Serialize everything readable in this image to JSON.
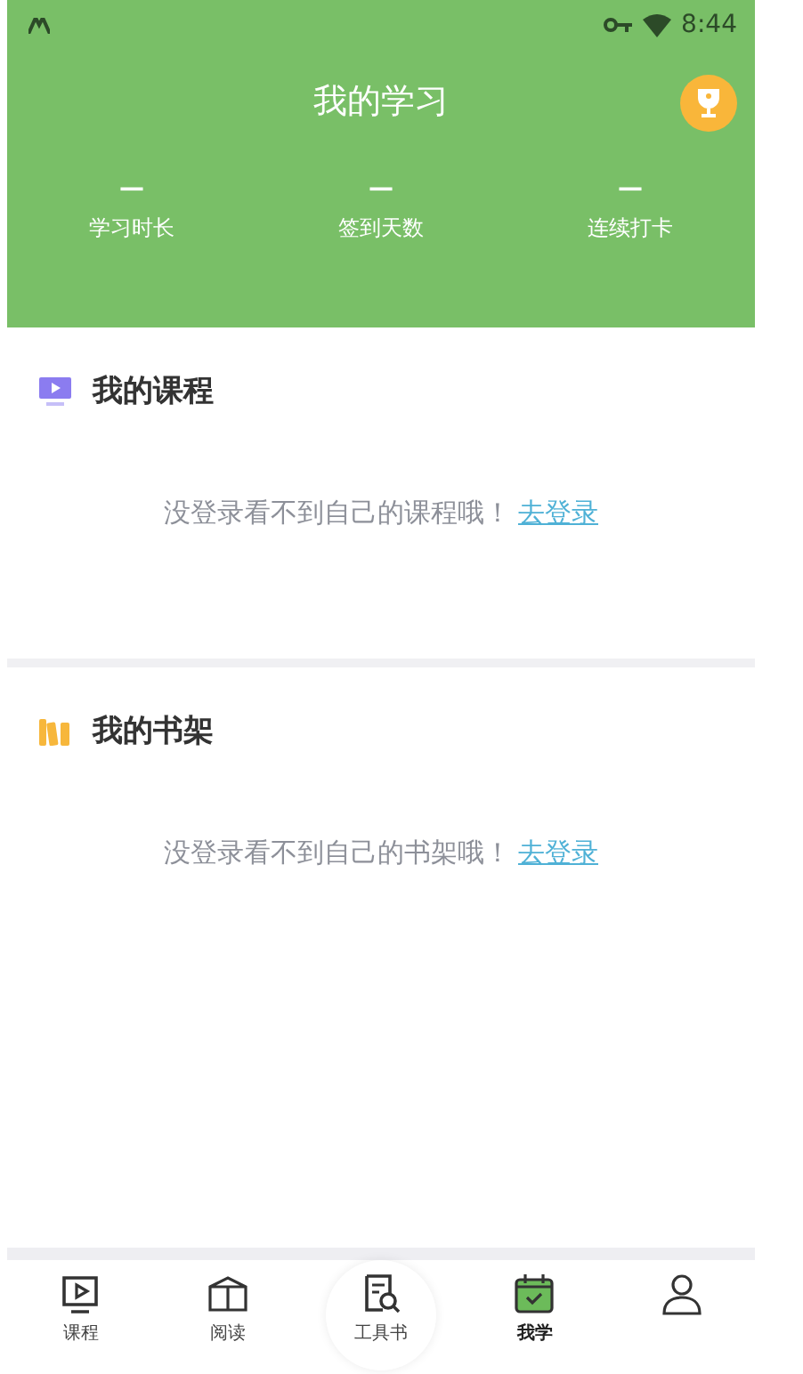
{
  "status_bar": {
    "time": "8:44"
  },
  "header": {
    "title": "我的学习"
  },
  "stats": [
    {
      "value": "—",
      "label": "学习时长"
    },
    {
      "value": "—",
      "label": "签到天数"
    },
    {
      "value": "—",
      "label": "连续打卡"
    }
  ],
  "sections": [
    {
      "kind": "courses",
      "title": "我的课程",
      "message": "没登录看不到自己的课程哦！",
      "link": "去登录"
    },
    {
      "kind": "shelf",
      "title": "我的书架",
      "message": "没登录看不到自己的书架哦！",
      "link": "去登录"
    }
  ],
  "tabs": [
    {
      "kind": "play",
      "label": "课程",
      "selected": false
    },
    {
      "kind": "book",
      "label": "阅读",
      "selected": false
    },
    {
      "kind": "tool",
      "label": "工具书",
      "selected": false
    },
    {
      "kind": "calendar",
      "label": "我学",
      "selected": true
    },
    {
      "kind": "person",
      "selected": false
    }
  ]
}
